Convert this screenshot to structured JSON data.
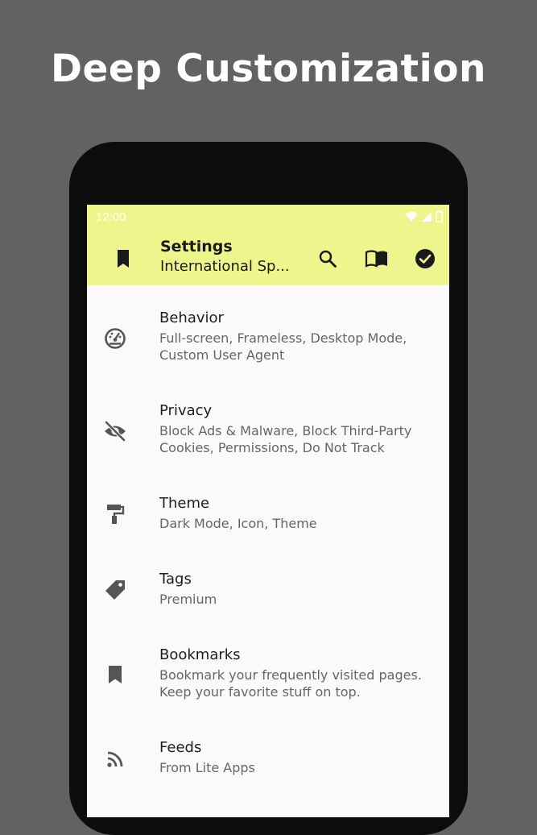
{
  "headline": "Deep Customization",
  "status_bar": {
    "time": "12:00",
    "icons": [
      "wifi-icon",
      "signal-icon",
      "battery-icon"
    ]
  },
  "app_bar": {
    "nav_icon": "bookmark-icon",
    "title": "Settings",
    "subtitle": "International Sp...",
    "actions": [
      "search-icon",
      "book-open-icon",
      "check-circle-icon"
    ]
  },
  "settings": [
    {
      "icon": "speedometer-icon",
      "label": "Behavior",
      "description": "Full-screen, Frameless, Desktop Mode, Custom User Agent"
    },
    {
      "icon": "eye-off-icon",
      "label": "Privacy",
      "description": "Block Ads & Malware, Block Third-Party Cookies, Permissions, Do Not Track"
    },
    {
      "icon": "paint-roller-icon",
      "label": "Theme",
      "description": "Dark Mode, Icon, Theme"
    },
    {
      "icon": "tag-icon",
      "label": "Tags",
      "description": "Premium"
    },
    {
      "icon": "bookmark-icon",
      "label": "Bookmarks",
      "description": "Bookmark your frequently visited pages. Keep your favorite stuff on top."
    },
    {
      "icon": "rss-icon",
      "label": "Feeds",
      "description": "From Lite Apps"
    }
  ],
  "colors": {
    "background": "#626262",
    "app_bar": "#eef58c",
    "list_bg": "#fafafa",
    "phone_frame": "#0c0c0c"
  }
}
